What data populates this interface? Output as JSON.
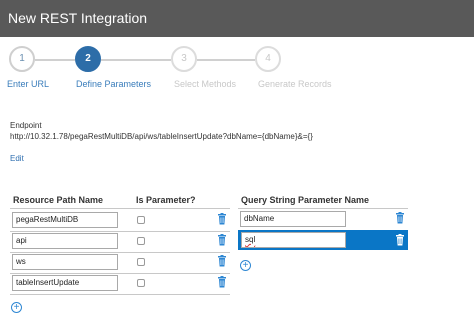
{
  "window": {
    "title": "New REST Integration"
  },
  "wizard": {
    "steps": [
      {
        "number": "1",
        "label": "Enter URL",
        "state": "completed"
      },
      {
        "number": "2",
        "label": "Define Parameters",
        "state": "active"
      },
      {
        "number": "3",
        "label": "Select Methods",
        "state": "disabled"
      },
      {
        "number": "4",
        "label": "Generate Records",
        "state": "disabled"
      }
    ]
  },
  "endpoint": {
    "label": "Endpoint",
    "value": "http://10.32.1.78/pegaRestMultiDB/api/ws/tableInsertUpdate?dbName={dbName}&={}",
    "edit_label": "Edit"
  },
  "resource_path": {
    "header_name": "Resource Path Name",
    "header_param": "Is Parameter?",
    "rows": [
      {
        "name": "pegaRestMultiDB",
        "is_parameter": false
      },
      {
        "name": "api",
        "is_parameter": false
      },
      {
        "name": "ws",
        "is_parameter": false
      },
      {
        "name": "tableInsertUpdate",
        "is_parameter": false
      }
    ]
  },
  "query_string": {
    "header_name": "Query String Parameter Name",
    "rows": [
      {
        "name": "dbName",
        "selected": false
      },
      {
        "name": "sql",
        "selected": true
      }
    ]
  },
  "colors": {
    "titlebar": "#595959",
    "accent": "#2d6da8",
    "selection": "#0a76c6",
    "icon_blue": "#2e87d3"
  }
}
